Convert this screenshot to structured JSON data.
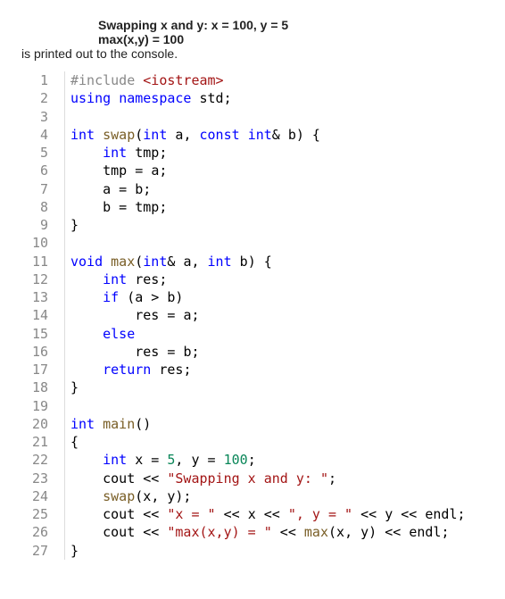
{
  "intro": {
    "line1": "Swapping x and y: x = 100, y = 5",
    "line2": "max(x,y) = 100",
    "text": "is printed out to the console."
  },
  "code": {
    "lines": [
      {
        "n": "1",
        "indent": 0,
        "tokens": [
          [
            "pp",
            "#include"
          ],
          [
            "op",
            " "
          ],
          [
            "inc",
            "<iostream>"
          ]
        ]
      },
      {
        "n": "2",
        "indent": 0,
        "tokens": [
          [
            "kw",
            "using"
          ],
          [
            "op",
            " "
          ],
          [
            "kw",
            "namespace"
          ],
          [
            "op",
            " "
          ],
          [
            "id",
            "std"
          ],
          [
            "op",
            ";"
          ]
        ]
      },
      {
        "n": "3",
        "indent": 0,
        "tokens": []
      },
      {
        "n": "4",
        "indent": 0,
        "tokens": [
          [
            "ty",
            "int"
          ],
          [
            "op",
            " "
          ],
          [
            "fn",
            "swap"
          ],
          [
            "op",
            "("
          ],
          [
            "ty",
            "int"
          ],
          [
            "op",
            " "
          ],
          [
            "id",
            "a"
          ],
          [
            "op",
            ", "
          ],
          [
            "kw",
            "const"
          ],
          [
            "op",
            " "
          ],
          [
            "ty",
            "int"
          ],
          [
            "op",
            "& "
          ],
          [
            "id",
            "b"
          ],
          [
            "op",
            ") {"
          ]
        ]
      },
      {
        "n": "5",
        "indent": 1,
        "tokens": [
          [
            "ty",
            "int"
          ],
          [
            "op",
            " "
          ],
          [
            "id",
            "tmp"
          ],
          [
            "op",
            ";"
          ]
        ]
      },
      {
        "n": "6",
        "indent": 1,
        "tokens": [
          [
            "id",
            "tmp"
          ],
          [
            "op",
            " = "
          ],
          [
            "id",
            "a"
          ],
          [
            "op",
            ";"
          ]
        ]
      },
      {
        "n": "7",
        "indent": 1,
        "tokens": [
          [
            "id",
            "a"
          ],
          [
            "op",
            " = "
          ],
          [
            "id",
            "b"
          ],
          [
            "op",
            ";"
          ]
        ]
      },
      {
        "n": "8",
        "indent": 1,
        "tokens": [
          [
            "id",
            "b"
          ],
          [
            "op",
            " = "
          ],
          [
            "id",
            "tmp"
          ],
          [
            "op",
            ";"
          ]
        ]
      },
      {
        "n": "9",
        "indent": 0,
        "tokens": [
          [
            "op",
            "}"
          ]
        ]
      },
      {
        "n": "10",
        "indent": 0,
        "tokens": []
      },
      {
        "n": "11",
        "indent": 0,
        "tokens": [
          [
            "ty",
            "void"
          ],
          [
            "op",
            " "
          ],
          [
            "fn",
            "max"
          ],
          [
            "op",
            "("
          ],
          [
            "ty",
            "int"
          ],
          [
            "op",
            "& "
          ],
          [
            "id",
            "a"
          ],
          [
            "op",
            ", "
          ],
          [
            "ty",
            "int"
          ],
          [
            "op",
            " "
          ],
          [
            "id",
            "b"
          ],
          [
            "op",
            ") {"
          ]
        ]
      },
      {
        "n": "12",
        "indent": 1,
        "tokens": [
          [
            "ty",
            "int"
          ],
          [
            "op",
            " "
          ],
          [
            "id",
            "res"
          ],
          [
            "op",
            ";"
          ]
        ]
      },
      {
        "n": "13",
        "indent": 1,
        "tokens": [
          [
            "kw",
            "if"
          ],
          [
            "op",
            " ("
          ],
          [
            "id",
            "a"
          ],
          [
            "op",
            " > "
          ],
          [
            "id",
            "b"
          ],
          [
            "op",
            ")"
          ]
        ]
      },
      {
        "n": "14",
        "indent": 2,
        "tokens": [
          [
            "id",
            "res"
          ],
          [
            "op",
            " = "
          ],
          [
            "id",
            "a"
          ],
          [
            "op",
            ";"
          ]
        ]
      },
      {
        "n": "15",
        "indent": 1,
        "tokens": [
          [
            "kw",
            "else"
          ]
        ]
      },
      {
        "n": "16",
        "indent": 2,
        "tokens": [
          [
            "id",
            "res"
          ],
          [
            "op",
            " = "
          ],
          [
            "id",
            "b"
          ],
          [
            "op",
            ";"
          ]
        ]
      },
      {
        "n": "17",
        "indent": 1,
        "tokens": [
          [
            "kw",
            "return"
          ],
          [
            "op",
            " "
          ],
          [
            "id",
            "res"
          ],
          [
            "op",
            ";"
          ]
        ]
      },
      {
        "n": "18",
        "indent": 0,
        "tokens": [
          [
            "op",
            "}"
          ]
        ]
      },
      {
        "n": "19",
        "indent": 0,
        "tokens": []
      },
      {
        "n": "20",
        "indent": 0,
        "tokens": [
          [
            "ty",
            "int"
          ],
          [
            "op",
            " "
          ],
          [
            "fn",
            "main"
          ],
          [
            "op",
            "()"
          ]
        ]
      },
      {
        "n": "21",
        "indent": 0,
        "tokens": [
          [
            "op",
            "{"
          ]
        ]
      },
      {
        "n": "22",
        "indent": 1,
        "tokens": [
          [
            "ty",
            "int"
          ],
          [
            "op",
            " "
          ],
          [
            "id",
            "x"
          ],
          [
            "op",
            " = "
          ],
          [
            "num",
            "5"
          ],
          [
            "op",
            ", "
          ],
          [
            "id",
            "y"
          ],
          [
            "op",
            " = "
          ],
          [
            "num",
            "100"
          ],
          [
            "op",
            ";"
          ]
        ]
      },
      {
        "n": "23",
        "indent": 1,
        "tokens": [
          [
            "id",
            "cout"
          ],
          [
            "op",
            " << "
          ],
          [
            "str",
            "\"Swapping x and y: \""
          ],
          [
            "op",
            ";"
          ]
        ]
      },
      {
        "n": "24",
        "indent": 1,
        "tokens": [
          [
            "fn",
            "swap"
          ],
          [
            "op",
            "("
          ],
          [
            "id",
            "x"
          ],
          [
            "op",
            ", "
          ],
          [
            "id",
            "y"
          ],
          [
            "op",
            ");"
          ]
        ]
      },
      {
        "n": "25",
        "indent": 1,
        "tokens": [
          [
            "id",
            "cout"
          ],
          [
            "op",
            " << "
          ],
          [
            "str",
            "\"x = \""
          ],
          [
            "op",
            " << "
          ],
          [
            "id",
            "x"
          ],
          [
            "op",
            " << "
          ],
          [
            "str",
            "\", y = \""
          ],
          [
            "op",
            " << "
          ],
          [
            "id",
            "y"
          ],
          [
            "op",
            " << "
          ],
          [
            "id",
            "endl"
          ],
          [
            "op",
            ";"
          ]
        ]
      },
      {
        "n": "26",
        "indent": 1,
        "tokens": [
          [
            "id",
            "cout"
          ],
          [
            "op",
            " << "
          ],
          [
            "str",
            "\"max(x,y) = \""
          ],
          [
            "op",
            " << "
          ],
          [
            "fn",
            "max"
          ],
          [
            "op",
            "("
          ],
          [
            "id",
            "x"
          ],
          [
            "op",
            ", "
          ],
          [
            "id",
            "y"
          ],
          [
            "op",
            ") << "
          ],
          [
            "id",
            "endl"
          ],
          [
            "op",
            ";"
          ]
        ]
      },
      {
        "n": "27",
        "indent": 0,
        "tokens": [
          [
            "op",
            "}"
          ]
        ]
      }
    ]
  }
}
